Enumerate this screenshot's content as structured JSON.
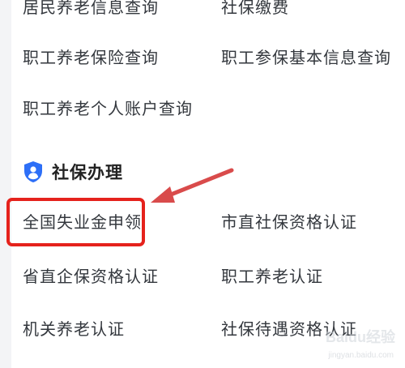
{
  "section_above": {
    "items": [
      "居民养老信息查询",
      "社保缴费",
      "职工养老保险查询",
      "职工参保基本信息查询",
      "职工养老个人账户查询"
    ]
  },
  "section": {
    "title": "社保办理",
    "icon": "shield-user-icon",
    "accent": "#2d6ff7",
    "items": [
      "全国失业金申领",
      "市直社保资格认证",
      "省直企保资格认证",
      "职工养老认证",
      "机关养老认证",
      "社保待遇资格认证"
    ]
  },
  "annotation": {
    "box_color": "#e5221c",
    "arrow_color": "#d94b4b"
  },
  "watermark": {
    "logo": "Baidu经验",
    "url": "jingyan.baidu.com"
  }
}
